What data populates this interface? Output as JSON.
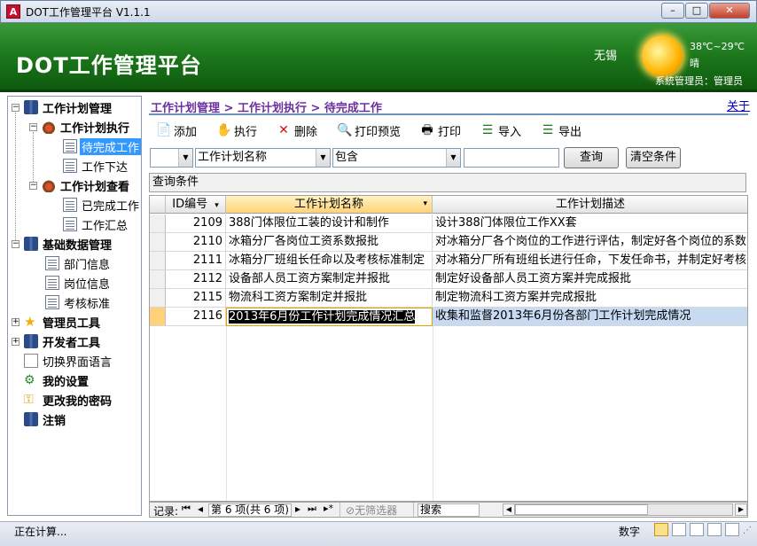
{
  "window": {
    "title": "DOT工作管理平台 V1.1.1",
    "app_icon": "A",
    "min": "–",
    "max": "□",
    "close": "✕"
  },
  "banner": {
    "title": "DOT工作管理平台",
    "city": "无锡",
    "temperature": "38℃~29℃",
    "weather": "晴",
    "user": "系統管理员：管理员",
    "sun_icon": "sun-icon"
  },
  "sidebar": {
    "items": [
      {
        "label": "工作计划管理",
        "icon": "book-icon"
      },
      {
        "label": "工作计划执行",
        "icon": "hand-icon"
      },
      {
        "label": "待完成工作",
        "icon": "doc-icon"
      },
      {
        "label": "工作下达",
        "icon": "doc-icon"
      },
      {
        "label": "工作计划查看",
        "icon": "hand-icon"
      },
      {
        "label": "已完成工作",
        "icon": "doc-icon"
      },
      {
        "label": "工作汇总",
        "icon": "doc-icon"
      },
      {
        "label": "基础数据管理",
        "icon": "book-icon"
      },
      {
        "label": "部门信息",
        "icon": "doc-icon"
      },
      {
        "label": "岗位信息",
        "icon": "doc-icon"
      },
      {
        "label": "考核标准",
        "icon": "doc-icon"
      },
      {
        "label": "管理员工具",
        "icon": "star-icon"
      },
      {
        "label": "开发者工具",
        "icon": "book-icon"
      },
      {
        "label": "切换界面语言",
        "icon": "language-icon"
      },
      {
        "label": "我的设置",
        "icon": "gear-icon"
      },
      {
        "label": "更改我的密码",
        "icon": "key-icon"
      },
      {
        "label": "注销",
        "icon": "book-icon"
      }
    ],
    "expanders": {
      "collapsed": "+",
      "expanded": "−"
    }
  },
  "breadcrumb": "工作计划管理 > 工作计划执行 > 待完成工作",
  "about": "关于",
  "toolbar": {
    "add": "添加",
    "execute": "执行",
    "delete": "删除",
    "print_preview": "打印预览",
    "print": "打印",
    "import": "导入",
    "export": "导出"
  },
  "query": {
    "field_prefix": "",
    "field": "工作计划名称",
    "operator": "包含",
    "value": "",
    "search_btn": "查询",
    "clear_btn": "清空条件",
    "conditions_label": "查询条件"
  },
  "grid": {
    "columns": [
      "ID编号",
      "工作计划名称",
      "工作计划描述"
    ],
    "sort_arrow": "▾",
    "rows": [
      {
        "id": "2109",
        "name": "388门体限位工装的设计和制作",
        "desc": "设计388门体限位工作XX套"
      },
      {
        "id": "2110",
        "name": "冰箱分厂各岗位工资系数报批",
        "desc": "对冰箱分厂各个岗位的工作进行评估，制定好各个岗位的系数"
      },
      {
        "id": "2111",
        "name": "冰箱分厂班组长任命以及考核标准制定",
        "desc": "对冰箱分厂所有班组长进行任命，下发任命书，并制定好考核"
      },
      {
        "id": "2112",
        "name": "设备部人员工资方案制定并报批",
        "desc": "制定好设备部人员工资方案并完成报批"
      },
      {
        "id": "2115",
        "name": "物流科工资方案制定并报批",
        "desc": "制定物流科工资方案并完成报批"
      },
      {
        "id": "2116",
        "name": "2013年6月份工作计划完成情况汇总",
        "desc": "收集和监督2013年6月份各部门工作计划完成情况"
      }
    ],
    "selected_index": 5
  },
  "navbar": {
    "record_label": "记录:",
    "first": "⏮",
    "prev": "◂",
    "position": "第 6 项(共 6 项)",
    "next": "▸",
    "last": "⏭",
    "new": "▸*",
    "filter": "无筛选器",
    "search": "搜索"
  },
  "status": {
    "left": "正在计算...",
    "mode": "数字"
  }
}
